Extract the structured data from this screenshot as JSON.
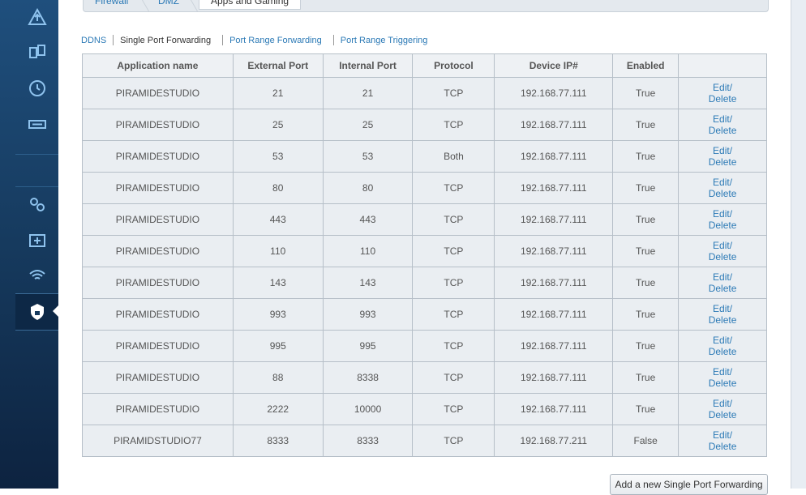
{
  "tabs": [
    {
      "label": "Firewall"
    },
    {
      "label": "DMZ"
    },
    {
      "label": "Apps and Gaming"
    }
  ],
  "subnav": {
    "ddns": "DDNS",
    "single": "Single Port Forwarding",
    "range": "Port Range Forwarding",
    "trigger": "Port Range Triggering"
  },
  "table": {
    "headers": [
      "Application name",
      "External Port",
      "Internal Port",
      "Protocol",
      "Device IP#",
      "Enabled",
      ""
    ],
    "rows": [
      {
        "app": "PIRAMIDESTUDIO",
        "ext": "21",
        "int": "21",
        "proto": "TCP",
        "ip": "192.168.77.111",
        "enabled": "True",
        "edit": "Edit/",
        "del": "Delete"
      },
      {
        "app": "PIRAMIDESTUDIO",
        "ext": "25",
        "int": "25",
        "proto": "TCP",
        "ip": "192.168.77.111",
        "enabled": "True",
        "edit": "Edit/",
        "del": "Delete"
      },
      {
        "app": "PIRAMIDESTUDIO",
        "ext": "53",
        "int": "53",
        "proto": "Both",
        "ip": "192.168.77.111",
        "enabled": "True",
        "edit": "Edit/",
        "del": "Delete"
      },
      {
        "app": "PIRAMIDESTUDIO",
        "ext": "80",
        "int": "80",
        "proto": "TCP",
        "ip": "192.168.77.111",
        "enabled": "True",
        "edit": "Edit/",
        "del": "Delete"
      },
      {
        "app": "PIRAMIDESTUDIO",
        "ext": "443",
        "int": "443",
        "proto": "TCP",
        "ip": "192.168.77.111",
        "enabled": "True",
        "edit": "Edit/",
        "del": "Delete"
      },
      {
        "app": "PIRAMIDESTUDIO",
        "ext": "110",
        "int": "110",
        "proto": "TCP",
        "ip": "192.168.77.111",
        "enabled": "True",
        "edit": "Edit/",
        "del": "Delete"
      },
      {
        "app": "PIRAMIDESTUDIO",
        "ext": "143",
        "int": "143",
        "proto": "TCP",
        "ip": "192.168.77.111",
        "enabled": "True",
        "edit": "Edit/",
        "del": "Delete"
      },
      {
        "app": "PIRAMIDESTUDIO",
        "ext": "993",
        "int": "993",
        "proto": "TCP",
        "ip": "192.168.77.111",
        "enabled": "True",
        "edit": "Edit/",
        "del": "Delete"
      },
      {
        "app": "PIRAMIDESTUDIO",
        "ext": "995",
        "int": "995",
        "proto": "TCP",
        "ip": "192.168.77.111",
        "enabled": "True",
        "edit": "Edit/",
        "del": "Delete"
      },
      {
        "app": "PIRAMIDESTUDIO",
        "ext": "88",
        "int": "8338",
        "proto": "TCP",
        "ip": "192.168.77.111",
        "enabled": "True",
        "edit": "Edit/",
        "del": "Delete"
      },
      {
        "app": "PIRAMIDESTUDIO",
        "ext": "2222",
        "int": "10000",
        "proto": "TCP",
        "ip": "192.168.77.111",
        "enabled": "True",
        "edit": "Edit/",
        "del": "Delete"
      },
      {
        "app": "PIRAMIDSTUDIO77",
        "ext": "8333",
        "int": "8333",
        "proto": "TCP",
        "ip": "192.168.77.211",
        "enabled": "False",
        "edit": "Edit/",
        "del": "Delete"
      }
    ]
  },
  "add_button": "Add a new Single Port Forwarding",
  "sidebar_icons": [
    "network-map-icon",
    "device-swap-icon",
    "clock-icon",
    "usb-icon",
    "settings-gears-icon",
    "troubleshoot-kit-icon",
    "wireless-lock-icon",
    "security-shield-icon"
  ],
  "colors": {
    "link": "#2c7ab6",
    "sidebar": "#1f4f7d"
  }
}
